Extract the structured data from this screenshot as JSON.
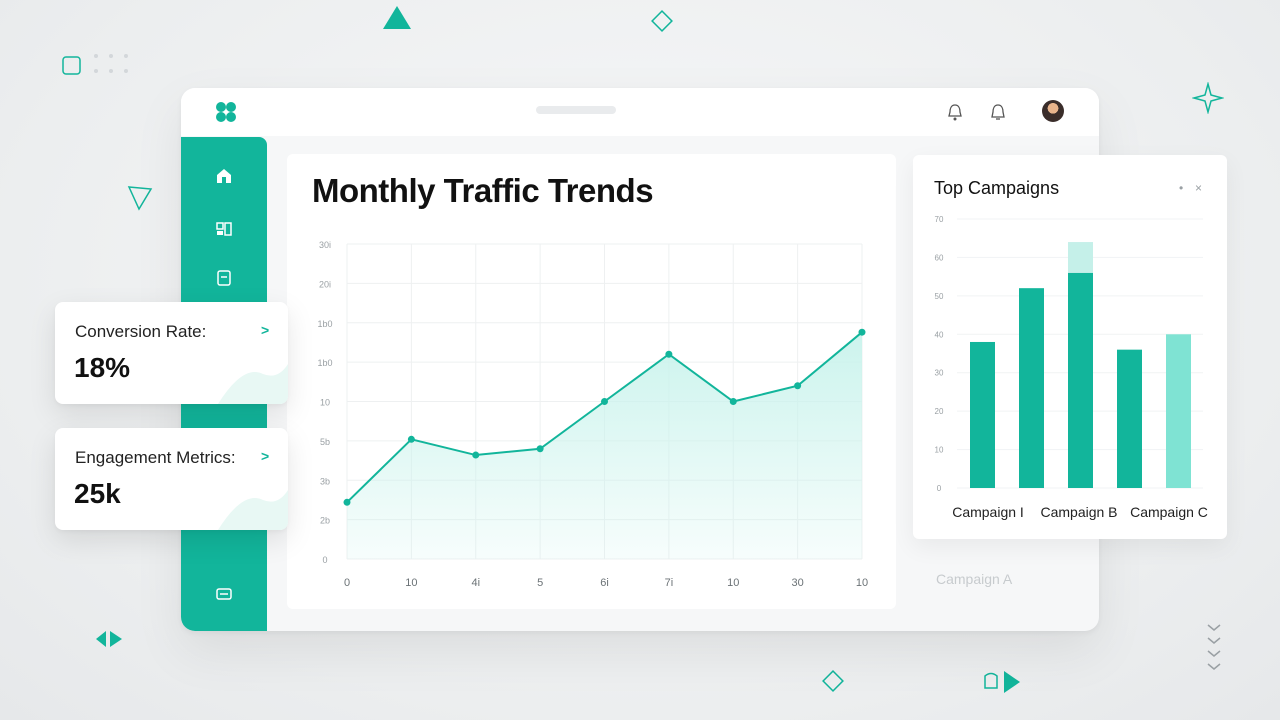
{
  "window": {
    "topbar": {
      "logo_icon": "clover-logo-icon",
      "icons": [
        "bell-icon",
        "notification-icon"
      ],
      "avatar": "user-avatar"
    },
    "sidebar": {
      "items": [
        {
          "icon": "home-icon"
        },
        {
          "icon": "dashboard-icon"
        },
        {
          "icon": "document-icon"
        },
        {
          "icon": "folder-icon"
        }
      ]
    },
    "ghost_label": "Campaign A"
  },
  "colors": {
    "accent": "#12b59b",
    "accent_light": "#7fe3d3",
    "area_fill": "#c9f3ec"
  },
  "traffic_chart": {
    "title": "Monthly Traffic Trends"
  },
  "campaigns_panel": {
    "title": "Top Campaigns",
    "controls": [
      "•",
      "×"
    ]
  },
  "stats": [
    {
      "label": "Conversion Rate:",
      "value": "18%",
      "arrow": ">"
    },
    {
      "label": "Engagement Metrics:",
      "value": "25k",
      "arrow": ">"
    }
  ],
  "chart_data": [
    {
      "type": "area",
      "title": "Monthly Traffic Trends",
      "x": [
        "0",
        "10",
        "4i",
        "5",
        "6i",
        "7i",
        "10",
        "30",
        "10"
      ],
      "y_ticks": [
        "0",
        "2b",
        "3b",
        "5b",
        "10",
        "1b0",
        "1b0",
        "20i",
        "30i"
      ],
      "values": [
        18,
        38,
        33,
        35,
        50,
        65,
        50,
        55,
        72
      ],
      "ylim": [
        0,
        100
      ],
      "grid": true
    },
    {
      "type": "bar",
      "title": "Top Campaigns",
      "categories": [
        "Campaign A",
        "Campaign B",
        "Campaign C"
      ],
      "category_labels": [
        "Campaign I",
        "Campaign B",
        "Campaign C"
      ],
      "y_ticks": [
        "0",
        "10",
        "20",
        "30",
        "40",
        "50",
        "60",
        "70"
      ],
      "ylim": [
        0,
        70
      ],
      "values": [
        38,
        52,
        56,
        36,
        40
      ],
      "extra_top": [
        null,
        null,
        8,
        null,
        null
      ],
      "bar_styles": [
        "solid",
        "solid",
        "solid",
        "solid",
        "light"
      ]
    }
  ]
}
